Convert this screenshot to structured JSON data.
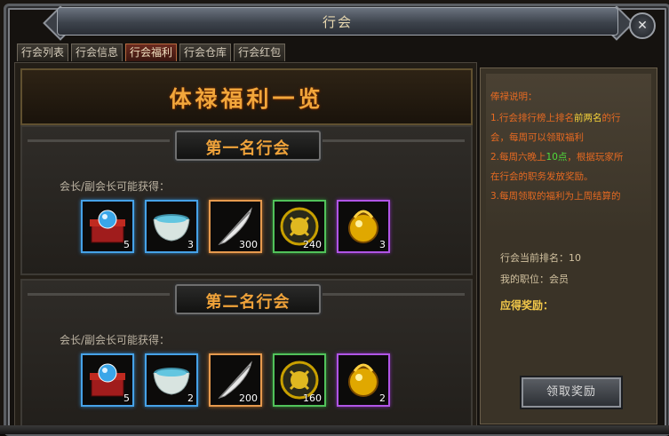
{
  "window": {
    "title": "行会"
  },
  "tabs": [
    {
      "label": "行会列表",
      "active": false
    },
    {
      "label": "行会信息",
      "active": false
    },
    {
      "label": "行会福利",
      "active": true
    },
    {
      "label": "行会仓库",
      "active": false
    },
    {
      "label": "行会红包",
      "active": false
    }
  ],
  "banner": {
    "title": "体禄福利一览"
  },
  "sections": [
    {
      "rank_title": "第一名行会",
      "sublabel": "会长/副会长可能获得：",
      "items": [
        {
          "icon": "treasure-chest-orb-icon",
          "rarity": "blue",
          "count": "5"
        },
        {
          "icon": "blue-bowl-icon",
          "rarity": "blue",
          "count": "3"
        },
        {
          "icon": "white-feather-icon",
          "rarity": "orange",
          "count": "300"
        },
        {
          "icon": "gold-emblem-icon",
          "rarity": "green",
          "count": "240"
        },
        {
          "icon": "golden-orb-icon",
          "rarity": "purple",
          "count": "3"
        }
      ]
    },
    {
      "rank_title": "第二名行会",
      "sublabel": "会长/副会长可能获得：",
      "items": [
        {
          "icon": "treasure-chest-orb-icon",
          "rarity": "blue",
          "count": "5"
        },
        {
          "icon": "blue-bowl-icon",
          "rarity": "blue",
          "count": "2"
        },
        {
          "icon": "white-feather-icon",
          "rarity": "orange",
          "count": "200"
        },
        {
          "icon": "gold-emblem-icon",
          "rarity": "green",
          "count": "160"
        },
        {
          "icon": "golden-orb-icon",
          "rarity": "purple",
          "count": "2"
        }
      ]
    }
  ],
  "description": {
    "heading": "俸禄说明：",
    "line1_a": "1.行会排行榜上排名",
    "line1_b": "前两名",
    "line1_c": "的行",
    "line2": "会，每周可以领取福利",
    "line3_a": "2.每周六晚上",
    "line3_b": "10点",
    "line3_c": "，根据玩家所",
    "line4": "在行会的职务发放奖励。",
    "line5": "3.每周领取的福利为上周结算的"
  },
  "status": {
    "rank_label": "行会当前排名：",
    "rank_value": "10",
    "position_label": "我的职位：",
    "position_value": "会员",
    "reward_label": "应得奖励："
  },
  "claim_button": "领取奖励",
  "colors": {
    "title_gold": "#f2a63b",
    "desc_orange": "#e66a22",
    "highlight_yellow": "#f5d23a",
    "highlight_green": "#4fdc3b"
  }
}
